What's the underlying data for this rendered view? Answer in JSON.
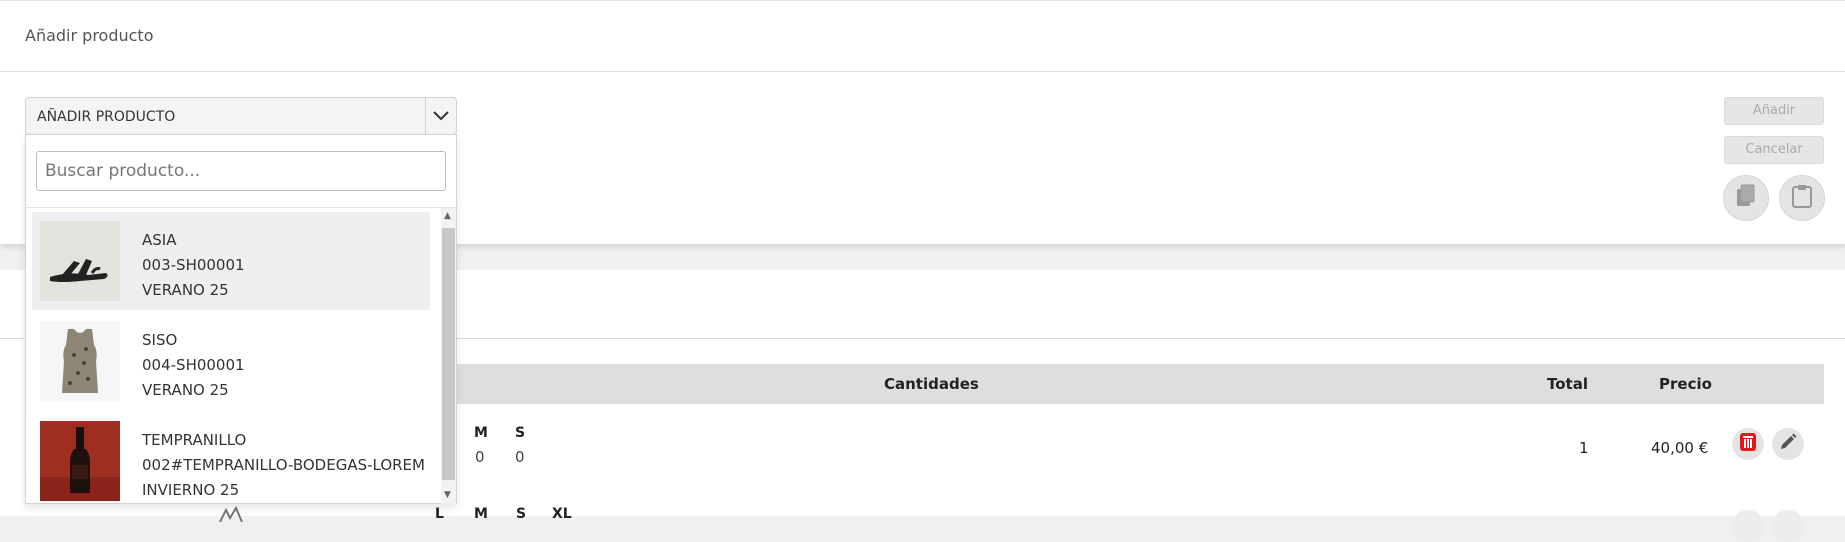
{
  "panel": {
    "title": "Añadir producto",
    "select_label": "AÑADIR PRODUCTO",
    "add_button": "Añadir",
    "cancel_button": "Cancelar"
  },
  "dropdown": {
    "search_placeholder": "Buscar producto...",
    "items": [
      {
        "name": "ASIA",
        "code": "003-SH00001",
        "season": "VERANO 25",
        "image": "black-sandal"
      },
      {
        "name": "SISO",
        "code": "004-SH00001",
        "season": "VERANO 25",
        "image": "leopard-tank-top"
      },
      {
        "name": "TEMPRANILLO",
        "code": "002#TEMPRANILLO-BODEGAS-LOREM",
        "season": "INVIERNO 25",
        "image": "wine-bottle"
      }
    ]
  },
  "table": {
    "headers": {
      "cantidades": "Cantidades",
      "total": "Total",
      "precio": "Precio"
    },
    "row1": {
      "sizes": [
        {
          "label": "M",
          "qty": "0"
        },
        {
          "label": "S",
          "qty": "0"
        }
      ],
      "total": "1",
      "price": "40,00 €"
    },
    "row2_sizes": [
      "L",
      "M",
      "S",
      "XL"
    ]
  },
  "icons": [
    "chevron-down-icon",
    "copy-icon",
    "clipboard-icon",
    "trash-icon",
    "pencil-icon"
  ],
  "colors": {
    "delete": "#e3161d",
    "header_bg": "#dedede"
  }
}
